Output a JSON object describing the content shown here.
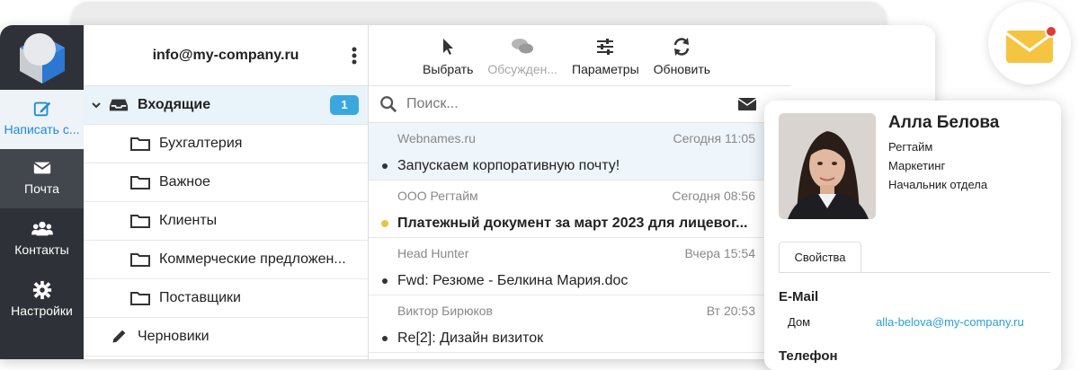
{
  "colors": {
    "accent": "#3aa8df",
    "sidebar": "#2e3238",
    "unread": "#f0c040",
    "link": "#2a9fd8",
    "notif_envelope": "#f5c542",
    "notif_dot": "#e53935"
  },
  "sidebar": {
    "items": [
      {
        "label": "Написать с...",
        "icon": "compose-icon"
      },
      {
        "label": "Почта",
        "icon": "envelope-icon"
      },
      {
        "label": "Контакты",
        "icon": "users-icon"
      },
      {
        "label": "Настройки",
        "icon": "gear-icon"
      }
    ]
  },
  "account": {
    "email": "info@my-company.ru"
  },
  "folders": {
    "inbox": {
      "label": "Входящие",
      "count": "1"
    },
    "items": [
      {
        "label": "Бухгалтерия"
      },
      {
        "label": "Важное"
      },
      {
        "label": "Клиенты"
      },
      {
        "label": "Коммерческие предложен..."
      },
      {
        "label": "Поставщики"
      }
    ],
    "drafts": {
      "label": "Черновики"
    }
  },
  "toolbar": {
    "select": "Выбрать",
    "discussions": "Обсужден...",
    "params": "Параметры",
    "refresh": "Обновить"
  },
  "search": {
    "placeholder": "Поиск..."
  },
  "messages": [
    {
      "from": "Webnames.ru",
      "date": "Сегодня 11:05",
      "subject": "Запускаем корпоративную почту!"
    },
    {
      "from": "ООО Регтайм",
      "date": "Сегодня 08:56",
      "subject": "Платежный документ за март 2023 для лицевог..."
    },
    {
      "from": "Head Hunter",
      "date": "Вчера 15:54",
      "subject": "Fwd: Резюме - Белкина Мария.doc"
    },
    {
      "from": "Виктор Бирюков",
      "date": "Вт 20:53",
      "subject": "Re[2]: Дизайн визиток"
    }
  ],
  "contact": {
    "name": "Алла Белова",
    "company": "Регтайм",
    "department": "Маркетинг",
    "position": "Начальник отдела",
    "tab": "Свойства",
    "email_section": "E-Mail",
    "email_type": "Дом",
    "email": "alla-belova@my-company.ru",
    "phone_section": "Телефон"
  }
}
